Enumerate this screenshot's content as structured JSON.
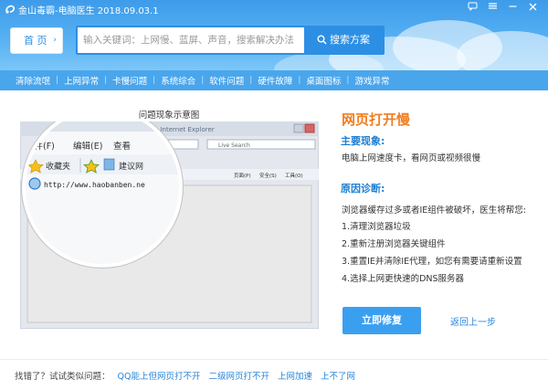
{
  "app": {
    "title": "金山毒霸-电脑医生 2018.09.03.1"
  },
  "window_controls": {
    "feedback_icon": "feedback-icon",
    "menu_icon": "menu-icon",
    "minimize_icon": "minimize-icon",
    "close_icon": "close-icon"
  },
  "header": {
    "home_label": "首 页",
    "search": {
      "placeholder": "输入关键词：上网慢、蓝屏、声音，搜索解决办法",
      "button_label": "搜索方案"
    }
  },
  "categories": [
    "清除流氓",
    "上网异常",
    "卡慢问题",
    "系统综合",
    "软件问题",
    "硬件故障",
    "桌面图标",
    "游戏异常"
  ],
  "illustration": {
    "title": "问题现象示意图",
    "browser_title": "Windows Internet Explorer",
    "address_text": "Live Search",
    "menu_file": "文件(F)",
    "menu_edit": "编辑(E)",
    "menu_view": "查看",
    "favorites_label": "收藏夹",
    "suggested_label": "建议网",
    "url_text": "http://www.haobanben.ne",
    "toolbar_page": "页面(P)",
    "toolbar_safety": "安全(S)",
    "toolbar_tools": "工具(O)"
  },
  "problem": {
    "title": "网页打开慢",
    "symptom_heading": "主要现象:",
    "symptom_text": "电脑上网速度卡，看网页或视频很慢",
    "cause_heading": "原因诊断:",
    "cause_text": "浏览器缓存过多或者IE组件被破坏，医生将帮您:",
    "steps": [
      "1.清理浏览器垃圾",
      "2.重新注册浏览器关键组件",
      "3.重置IE并清除IE代理，如您有需要请重新设置",
      "4.选择上网更快速的DNS服务器"
    ],
    "fix_button": "立即修复",
    "back_link": "返回上一步"
  },
  "footer": {
    "label": "找错了？试试类似问题：",
    "links": [
      "QQ能上但网页打不开",
      "二级网页打不开",
      "上网加速",
      "上不了网"
    ]
  },
  "colors": {
    "header_top": "#3d9be9",
    "nav_bar": "#4aa6ec",
    "accent_blue": "#2d8fe4",
    "title_orange": "#f07d1f",
    "heading_blue": "#1f7fd1"
  }
}
